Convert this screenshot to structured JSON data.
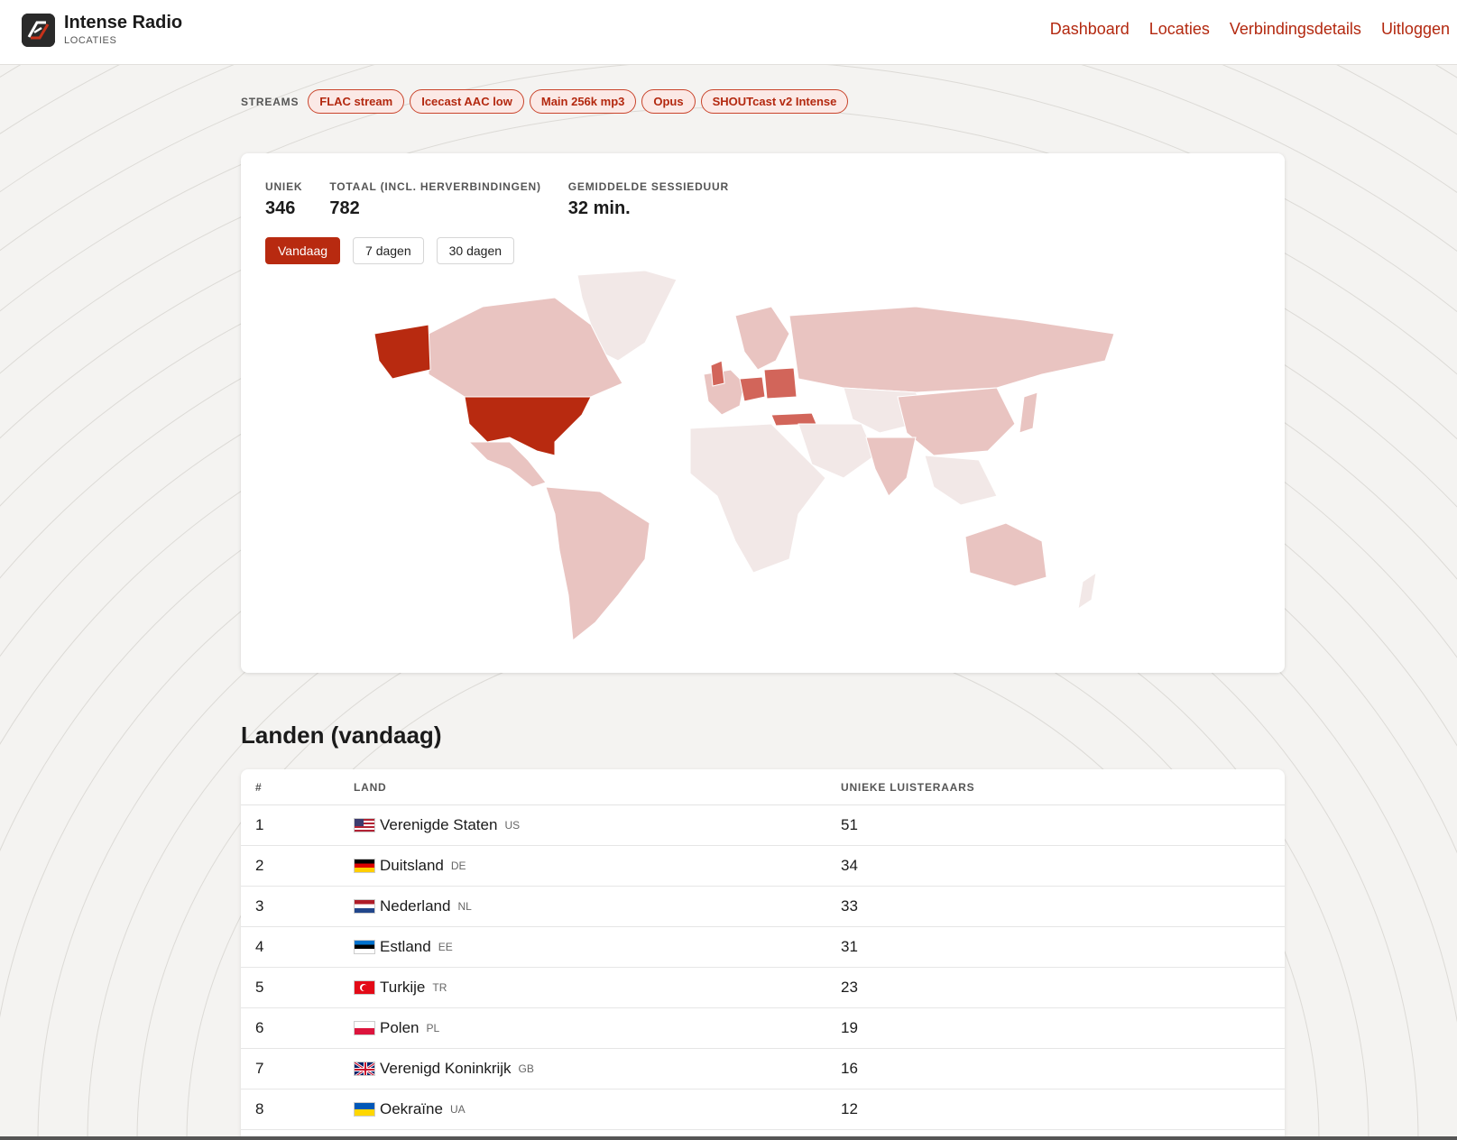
{
  "header": {
    "brand_title": "Intense Radio",
    "brand_subtitle": "LOCATIES",
    "nav": [
      {
        "label": "Dashboard"
      },
      {
        "label": "Locaties"
      },
      {
        "label": "Verbindingsdetails"
      },
      {
        "label": "Uitloggen"
      }
    ]
  },
  "streams": {
    "label": "STREAMS",
    "items": [
      "FLAC stream",
      "Icecast AAC low",
      "Main 256k mp3",
      "Opus",
      "SHOUTcast v2 Intense"
    ]
  },
  "stats": [
    {
      "label": "UNIEK",
      "value": "346"
    },
    {
      "label": "TOTAAL (INCL. HERVERBINDINGEN)",
      "value": "782"
    },
    {
      "label": "GEMIDDELDE SESSIEDUUR",
      "value": "32 min."
    }
  ],
  "ranges": {
    "items": [
      "Vandaag",
      "7 dagen",
      "30 dagen"
    ],
    "active": "Vandaag"
  },
  "map": {
    "colors": {
      "max": "#b82a10",
      "high": "#d2655a",
      "mid": "#e9c4c1",
      "low": "#f2e8e7"
    }
  },
  "countries": {
    "title": "Landen (vandaag)",
    "columns": [
      "#",
      "LAND",
      "UNIEKE LUISTERAARS"
    ],
    "rows": [
      {
        "rank": "1",
        "name": "Verenigde Staten",
        "code": "US",
        "listeners": "51",
        "flag": "us"
      },
      {
        "rank": "2",
        "name": "Duitsland",
        "code": "DE",
        "listeners": "34",
        "flag": "de"
      },
      {
        "rank": "3",
        "name": "Nederland",
        "code": "NL",
        "listeners": "33",
        "flag": "nl"
      },
      {
        "rank": "4",
        "name": "Estland",
        "code": "EE",
        "listeners": "31",
        "flag": "ee"
      },
      {
        "rank": "5",
        "name": "Turkije",
        "code": "TR",
        "listeners": "23",
        "flag": "tr"
      },
      {
        "rank": "6",
        "name": "Polen",
        "code": "PL",
        "listeners": "19",
        "flag": "pl"
      },
      {
        "rank": "7",
        "name": "Verenigd Koninkrijk",
        "code": "GB",
        "listeners": "16",
        "flag": "gb"
      },
      {
        "rank": "8",
        "name": "Oekraïne",
        "code": "UA",
        "listeners": "12",
        "flag": "ua"
      }
    ]
  }
}
